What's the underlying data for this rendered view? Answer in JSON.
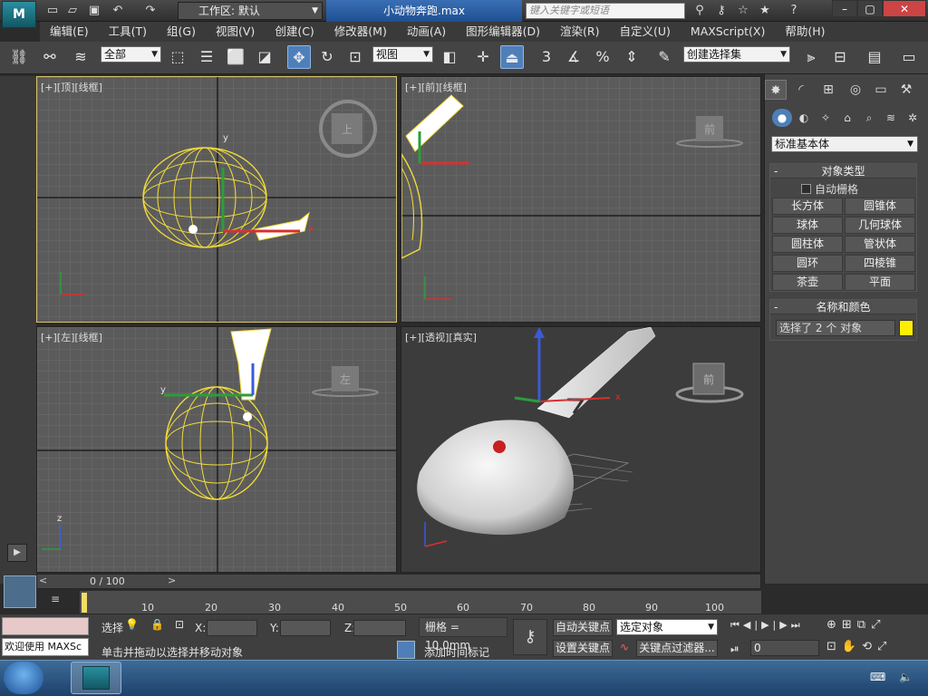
{
  "titlebar": {
    "workspace": "工作区: 默认",
    "file_title": "小动物奔跑.max",
    "search_placeholder": "键入关键字或短语"
  },
  "menu": [
    "编辑(E)",
    "工具(T)",
    "组(G)",
    "视图(V)",
    "创建(C)",
    "修改器(M)",
    "动画(A)",
    "图形编辑器(D)",
    "渲染(R)",
    "自定义(U)",
    "MAXScript(X)",
    "帮助(H)"
  ],
  "toolbar": {
    "filter": "全部",
    "ref_coord": "视图",
    "named_sel": "创建选择集",
    "snap_label": "3",
    "percent_label": "%"
  },
  "viewports": {
    "top": {
      "label": "[+][顶][线框]",
      "cube": "上"
    },
    "front": {
      "label": "[+][前][线框]",
      "cube": "前"
    },
    "left": {
      "label": "[+][左][线框]",
      "cube": "左"
    },
    "persp": {
      "label": "[+][透视][真实]",
      "cube": "前"
    }
  },
  "axis": {
    "x": "x",
    "y": "y",
    "z": "z"
  },
  "command_panel": {
    "category": "标准基本体",
    "object_type": {
      "title": "对象类型",
      "auto_grid": "自动栅格",
      "buttons": [
        "长方体",
        "圆锥体",
        "球体",
        "几何球体",
        "圆柱体",
        "管状体",
        "圆环",
        "四棱锥",
        "茶壶",
        "平面"
      ]
    },
    "name_color": {
      "title": "名称和颜色",
      "value": "选择了 2 个 对象",
      "swatch": "#ffee00"
    }
  },
  "timeline": {
    "slider": "0 / 100",
    "ticks": [
      10,
      20,
      30,
      40,
      50,
      60,
      70,
      80,
      90,
      100
    ]
  },
  "status": {
    "welcome": "欢迎使用 MAXSc",
    "select_label": "选择",
    "prompt": "单击并拖动以选择并移动对象",
    "x": "X:",
    "y": "Y:",
    "z": "Z:",
    "grid": "栅格 = 10.0mm",
    "auto_key": "自动关键点",
    "set_key": "设置关键点",
    "selected_object": "选定对象",
    "key_filters": "关键点过滤器...",
    "add_time_tag": "添加时间标记",
    "frame": "0"
  }
}
